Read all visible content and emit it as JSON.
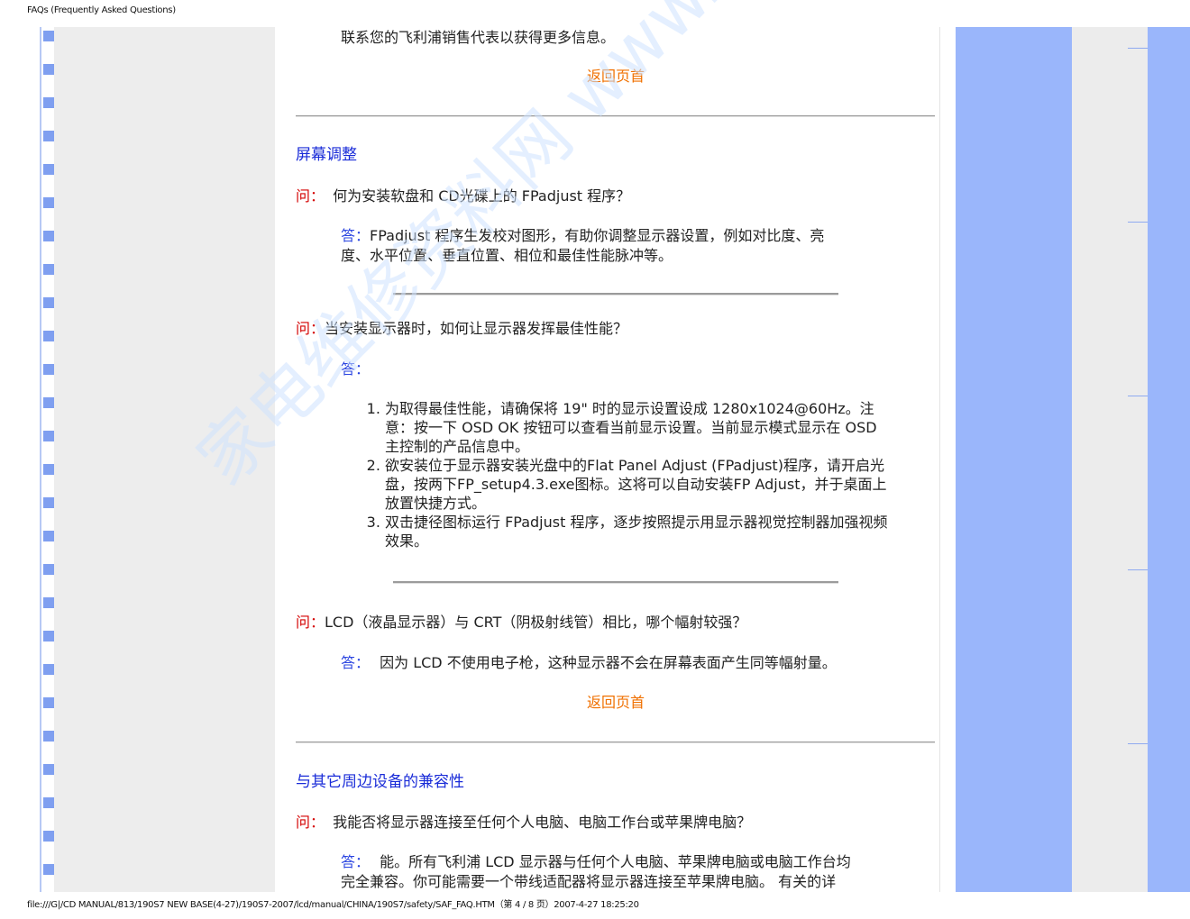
{
  "header": {
    "title": "FAQs (Frequently Asked Questions)"
  },
  "footer": {
    "path": "file:///G|/CD MANUAL/813/190S7 NEW BASE(4-27)/190S7-2007/lcd/manual/CHINA/190S7/safety/SAF_FAQ.HTM（第 4 / 8 页）2007-4-27 18:25:20"
  },
  "watermark": "家电维修资料网 www.520101.com",
  "colors": {
    "question": "#d40000",
    "answer": "#2a44e0",
    "section": "#1a2cd8",
    "back_to_top": "#f07000",
    "side_blue": "#9ab6fb"
  },
  "content": {
    "contact_text": "联系您的飞利浦销售代表以获得更多信息。",
    "back_to_top_1": "返回页首",
    "section_1_title": "屏幕调整",
    "q1_label": "问：",
    "q1_text": "何为安装软盘和 CD光碟上的 FPadjust 程序？",
    "a1_label": "答：",
    "a1_line1": "FPadjust 程序生发校对图形，有助你调整显示器设置，例如对比度、亮",
    "a1_line2": "度、水平位置、垂直位置、相位和最佳性能脉冲等。",
    "q2_label": "问：",
    "q2_text": "当安装显示器时，如何让显示器发挥最佳性能？",
    "a2_label": "答：",
    "a2_items": [
      "为取得最佳性能，请确保将 19\" 时的显示设置设成 1280x1024@60Hz。注意：按一下 OSD OK 按钮可以查看当前显示设置。当前显示模式显示在 OSD 主控制的产品信息中。",
      "欲安装位于显示器安装光盘中的Flat Panel Adjust (FPadjust)程序，请开启光盘，按两下FP_setup4.3.exe图标。这将可以自动安装FP Adjust，并于桌面上放置快捷方式。",
      "双击捷径图标运行 FPadjust 程序，逐步按照提示用显示器视觉控制器加强视频效果。"
    ],
    "q3_label": "问：",
    "q3_text": "LCD（液晶显示器）与 CRT（阴极射线管）相比，哪个幅射较强？",
    "a3_label": "答：",
    "a3_text": "因为 LCD 不使用电子枪，这种显示器不会在屏幕表面产生同等幅射量。",
    "back_to_top_2": "返回页首",
    "section_2_title": "与其它周边设备的兼容性",
    "q4_label": "问：",
    "q4_text": "我能否将显示器连接至任何个人电脑、电脑工作台或苹果牌电脑？",
    "a4_label": "答：",
    "a4_line1": "能。所有飞利浦 LCD 显示器与任何个人电脑、苹果牌电脑或电脑工作台均",
    "a4_line2": "完全兼容。你可能需要一个带线适配器将显示器连接至苹果牌电脑。 有关的详"
  }
}
